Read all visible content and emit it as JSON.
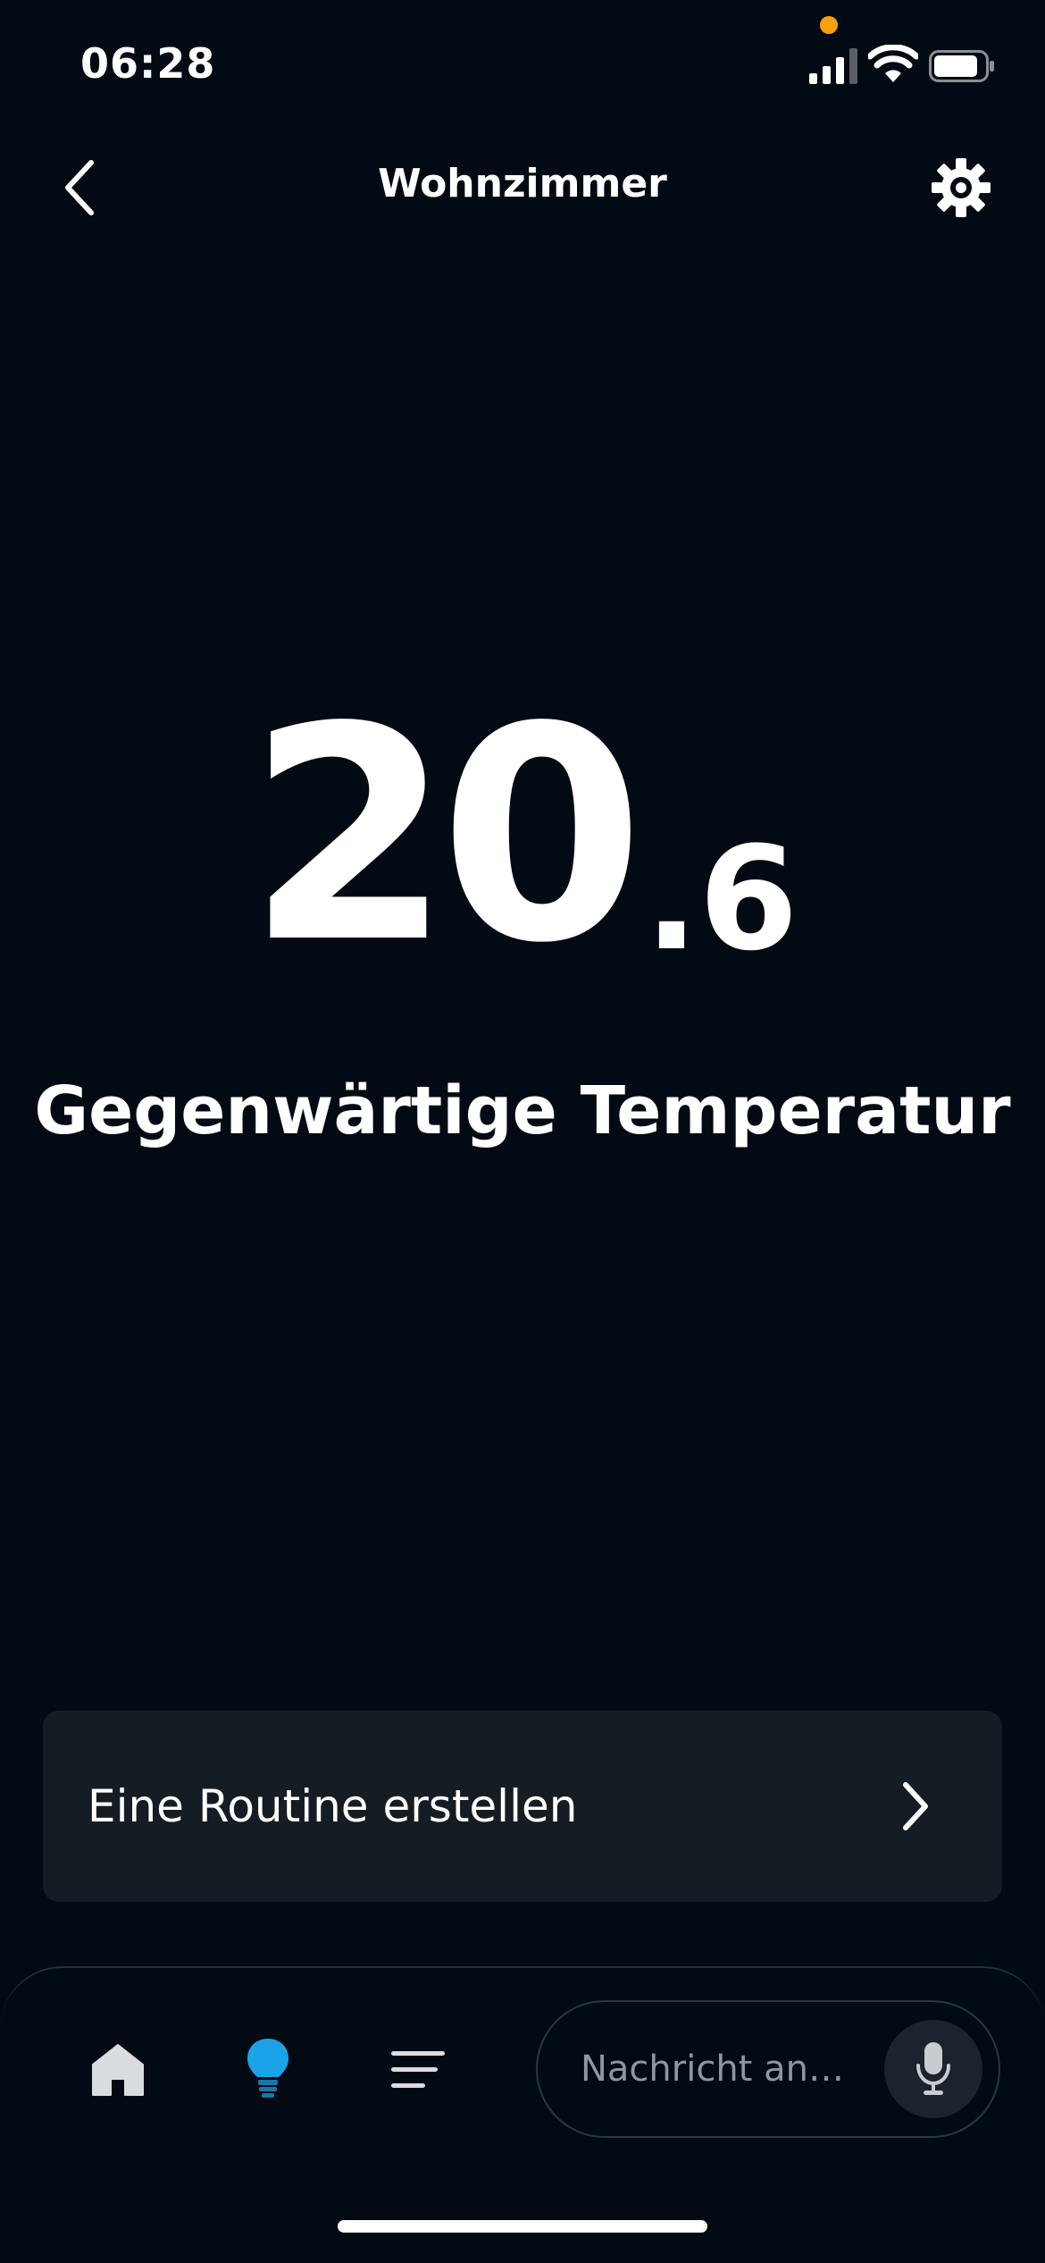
{
  "status_bar": {
    "time": "06:28",
    "privacy_dot_color": "#ff9f0a",
    "icons": [
      "cellular-signal-icon",
      "wifi-icon",
      "battery-icon"
    ]
  },
  "header": {
    "title": "Wohnzimmer",
    "back_icon": "chevron-left-icon",
    "settings_icon": "gear-icon"
  },
  "temperature": {
    "integer": "20",
    "decimal": ".6",
    "label": "Gegenwärtige Temperatur"
  },
  "routine_card": {
    "label": "Eine Routine erstellen",
    "icon": "chevron-right-icon"
  },
  "bottom_nav": {
    "items": [
      {
        "name": "home",
        "icon": "home-icon",
        "active": false
      },
      {
        "name": "devices",
        "icon": "light-bulb-icon",
        "active": true
      },
      {
        "name": "more",
        "icon": "menu-lines-icon",
        "active": false
      }
    ],
    "active_color": "#1ba3e8",
    "message_placeholder": "Nachricht an…",
    "mic_icon": "microphone-icon"
  },
  "colors": {
    "background": "#020a13",
    "card": "#141c24",
    "text": "#ffffff",
    "muted_text": "#8e969e"
  }
}
